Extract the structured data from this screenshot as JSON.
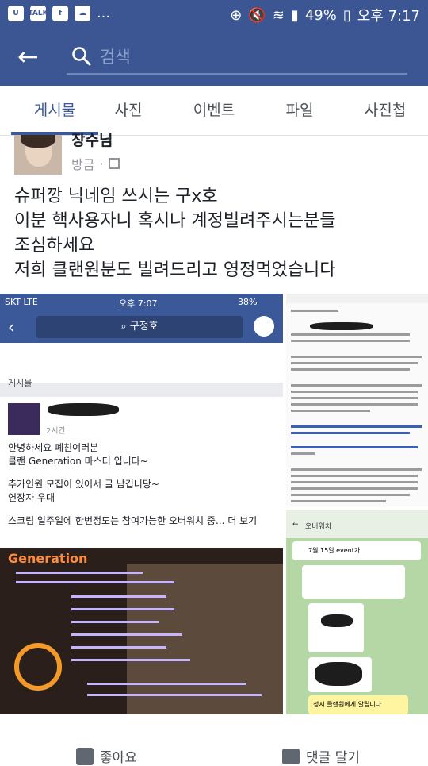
{
  "statusbar": {
    "battery": "49%",
    "time": "오후 7:17"
  },
  "search": {
    "placeholder": "검색"
  },
  "tabs": [
    {
      "label": "게시물"
    },
    {
      "label": "사진"
    },
    {
      "label": "이벤트"
    },
    {
      "label": "파일"
    },
    {
      "label": "사진첩"
    }
  ],
  "post": {
    "author": "장수님",
    "time": "방금",
    "lines": [
      "슈퍼깡 닉네임 쓰시는 구x호",
      "이분 핵사용자니 혹시나 계정빌려주시는분들",
      "조심하세요",
      "저희 클랜원분도 빌려드리고 영정먹었습니다"
    ]
  },
  "screenshot_left": {
    "carrier": "SKT  LTE",
    "time": "오후 7:07",
    "battery": "38%",
    "search_text": "구정호",
    "section": "게시물",
    "post_time": "2시간",
    "lines": [
      "안녕하세요 폐친여러분",
      "클랜 Generation 마스터 입니다~",
      "",
      "추가인원 모집이 있어서 글 남깁니당~",
      "연장자 우대",
      "",
      "스크림 일주일에 한번정도는 참여가능한 오버워치 중...  더 보기"
    ],
    "banner_title": "Generation"
  },
  "screenshot_right_bottom": {
    "title": "오버워치",
    "event": "7월 15일 event가",
    "note": "정시 클랜원에게 알립니다"
  },
  "actions": {
    "like": "좋아요",
    "comment": "댓글 달기"
  }
}
